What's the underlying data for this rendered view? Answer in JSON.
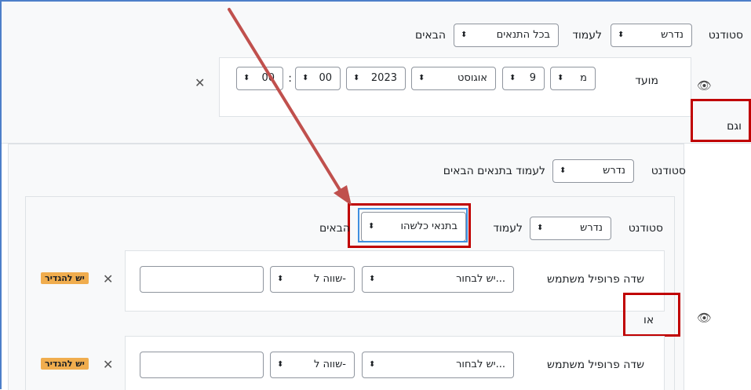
{
  "top": {
    "student_label": "סטודנט",
    "required_select": "נדרש",
    "to_meet_label": "לעמוד",
    "all_conditions_select": "בכל התנאים",
    "following_label": "הבאים"
  },
  "date_condition": {
    "label": "מועד",
    "from_select": "מ",
    "day_select": "9",
    "month_select": "אוגוסט",
    "year_select": "2023",
    "hour_select": "00",
    "minute_select": "00",
    "time_separator": ":"
  },
  "and_label": "וגם",
  "nested": {
    "student_label": "סטודנט",
    "required_select": "נדרש",
    "to_meet_label": "לעמוד בתנאים הבאים"
  },
  "inner": {
    "student_label": "סטודנט",
    "required_select": "נדרש",
    "to_meet_label": "לעמוד",
    "any_condition_select": "בתנאי כלשהו",
    "following_label": "הבאים"
  },
  "profile_rows": [
    {
      "label": "שדה פרופיל משתמש",
      "field_select": "יש לבחור...",
      "operator_select": "שווה ל-",
      "value": "",
      "badge": "יש להגדיר"
    },
    {
      "label": "שדה פרופיל משתמש",
      "field_select": "יש לבחור...",
      "operator_select": "שווה ל-",
      "value": "",
      "badge": "יש להגדיר"
    }
  ],
  "or_label": "או",
  "icons": {
    "sort_arrows": "⬍",
    "close": "✕",
    "eye": "👁"
  },
  "colors": {
    "highlight_red": "#c00000",
    "arrow": "#c0504d",
    "focus_blue": "#3f8fe0",
    "badge": "#f0ad4e"
  }
}
